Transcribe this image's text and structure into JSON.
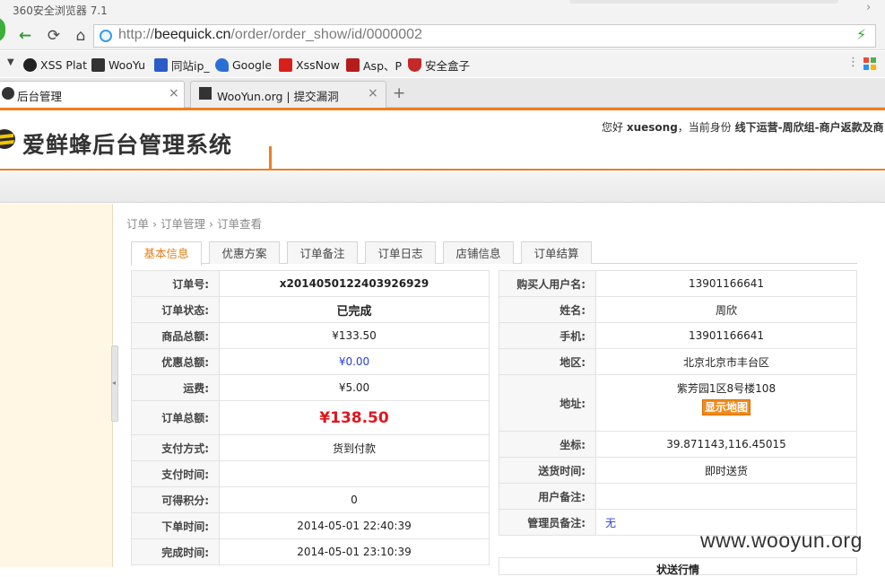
{
  "browser": {
    "title": "360安全浏览器 7.1",
    "url_proto": "http://",
    "url_host": "beequick.cn",
    "url_path": "/order/order_show/id/0000002",
    "bookmarks": [
      "XSS Plat",
      "WooYu",
      "同站ip_",
      "Google",
      "XssNow",
      "Asp、P",
      "安全盒子"
    ],
    "tabs": [
      {
        "label": "后台管理"
      },
      {
        "label": "WooYun.org | 提交漏洞"
      }
    ]
  },
  "header": {
    "system_title": "爱鲜蜂后台管理系统",
    "greeting": "您好",
    "username": "xuesong",
    "role_prefix": "，当前身份",
    "role": "线下运营-周欣组-商户返款及商"
  },
  "breadcrumb": [
    "订单",
    "›",
    "订单管理",
    "›",
    "订单查看"
  ],
  "order_tabs": [
    "基本信息",
    "优惠方案",
    "订单备注",
    "订单日志",
    "店铺信息",
    "订单结算"
  ],
  "left_table": [
    {
      "label": "订单号:",
      "value": "x20140501224039269​29"
    },
    {
      "label": "订单状态:",
      "value": "已完成"
    },
    {
      "label": "商品总额:",
      "value": "¥133.50"
    },
    {
      "label": "优惠总额:",
      "value": "¥0.00"
    },
    {
      "label": "运费:",
      "value": "¥5.00"
    },
    {
      "label": "订单总额:",
      "value": "¥138.50"
    },
    {
      "label": "支付方式:",
      "value": "货到付款"
    },
    {
      "label": "支付时间:",
      "value": ""
    },
    {
      "label": "可得积分:",
      "value": "0"
    },
    {
      "label": "下单时间:",
      "value": "2014-05-01 22:40:39"
    },
    {
      "label": "完成时间:",
      "value": "2014-05-01 23:10:39"
    }
  ],
  "right_table": [
    {
      "label": "购买人用户名:",
      "value": "13901166641"
    },
    {
      "label": "姓名:",
      "value": "周欣"
    },
    {
      "label": "手机:",
      "value": "13901166641"
    },
    {
      "label": "地区:",
      "value": "北京北京市丰台区"
    },
    {
      "label": "地址:",
      "value": "紫芳园1区8号楼108",
      "button": "显示地图"
    },
    {
      "label": "坐标:",
      "value": "39.871143,116.45015"
    },
    {
      "label": "送货时间:",
      "value": "即时送货"
    },
    {
      "label": "用户备注:",
      "value": ""
    },
    {
      "label": "管理员备注:",
      "value": "无"
    }
  ],
  "bottom_box_title": "状送行情",
  "watermark": "www.wooyun.org",
  "colors": {
    "accent": "#f07d21",
    "price_red": "#e1161c",
    "link_blue": "#2b3fcf"
  }
}
